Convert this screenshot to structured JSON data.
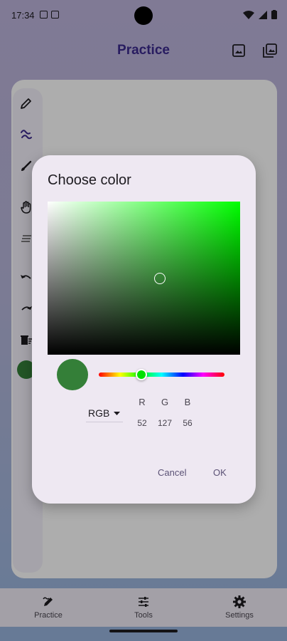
{
  "status_bar": {
    "time": "17:34"
  },
  "app_bar": {
    "title": "Practice",
    "icons": [
      "image-icon",
      "gallery-icon"
    ]
  },
  "tool_rail": {
    "tools": [
      "pencil-icon",
      "squiggle-icon",
      "brush-icon",
      "hand-icon",
      "lines-icon",
      "undo-icon",
      "redo-icon",
      "delete-icon"
    ],
    "current_color": "#347f38"
  },
  "dialog": {
    "title": "Choose color",
    "hue_color": "#00ff00",
    "preview_color": "#347f38",
    "mode": "RGB",
    "channels": [
      {
        "label": "R",
        "value": "52"
      },
      {
        "label": "G",
        "value": "127"
      },
      {
        "label": "B",
        "value": "56"
      }
    ],
    "cancel_label": "Cancel",
    "ok_label": "OK"
  },
  "bottom_nav": {
    "items": [
      {
        "label": "Practice",
        "icon": "draw-icon"
      },
      {
        "label": "Tools",
        "icon": "sliders-icon"
      },
      {
        "label": "Settings",
        "icon": "gear-icon"
      }
    ]
  }
}
